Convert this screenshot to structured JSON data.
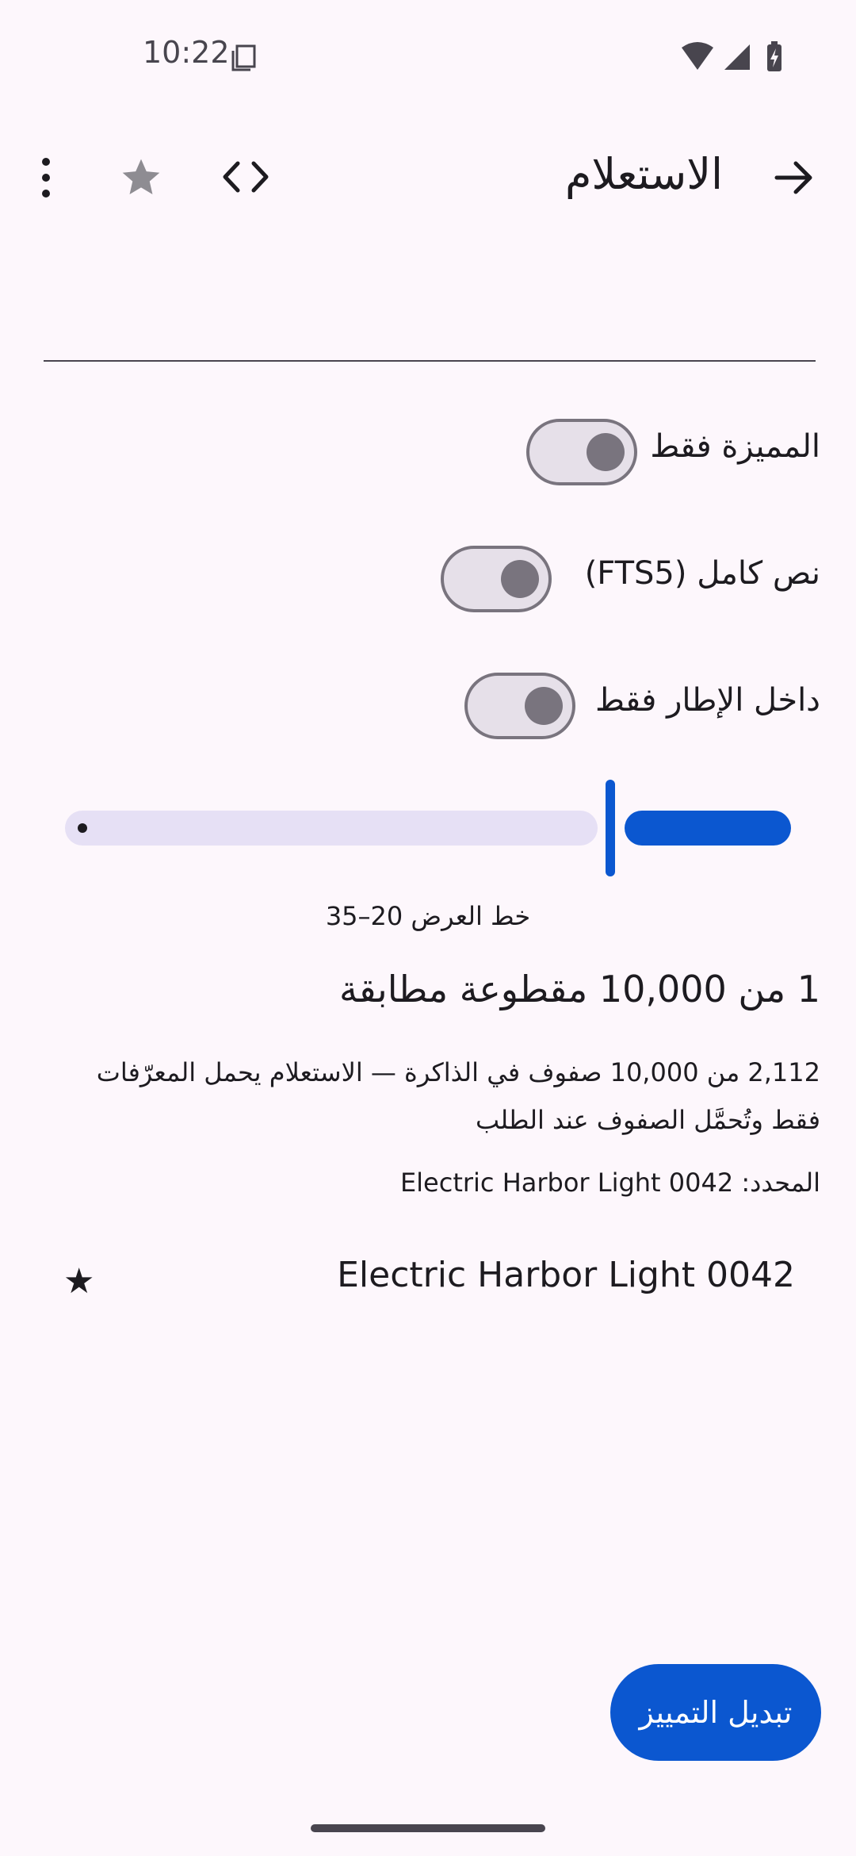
{
  "status_bar": {
    "time": "10:22"
  },
  "app_bar": {
    "title": "الاستعلام",
    "icons": [
      "arrow-forward-icon",
      "code-icon",
      "star-icon",
      "more-vert-icon"
    ]
  },
  "query": {
    "value": "",
    "placeholder": ""
  },
  "switches": [
    {
      "label": "المميزة فقط",
      "on": false
    },
    {
      "label": "نص كامل (FTS5)",
      "on": false
    },
    {
      "label": "داخل الإطار فقط",
      "on": false
    }
  ],
  "slider": {
    "caption": "خط العرض 20–35",
    "value_fraction": 0.75
  },
  "results": {
    "match_count": "1 من 10,000 مقطوعة مطابقة",
    "memory_note": "2,112 من 10,000 صفوف في الذاكرة — الاستعلام يحمل المعرّفات فقط وتُحمَّل الصفوف عند الطلب",
    "selected": "المحدد: Electric Harbor Light 0042",
    "items": [
      {
        "title": "Electric Harbor Light 0042",
        "star": "★"
      }
    ]
  },
  "fab": {
    "label": "تبديل التمييز"
  },
  "colors": {
    "accent": "#0B57D0",
    "background": "#FDF7FC",
    "switch_off": "#79747E"
  }
}
